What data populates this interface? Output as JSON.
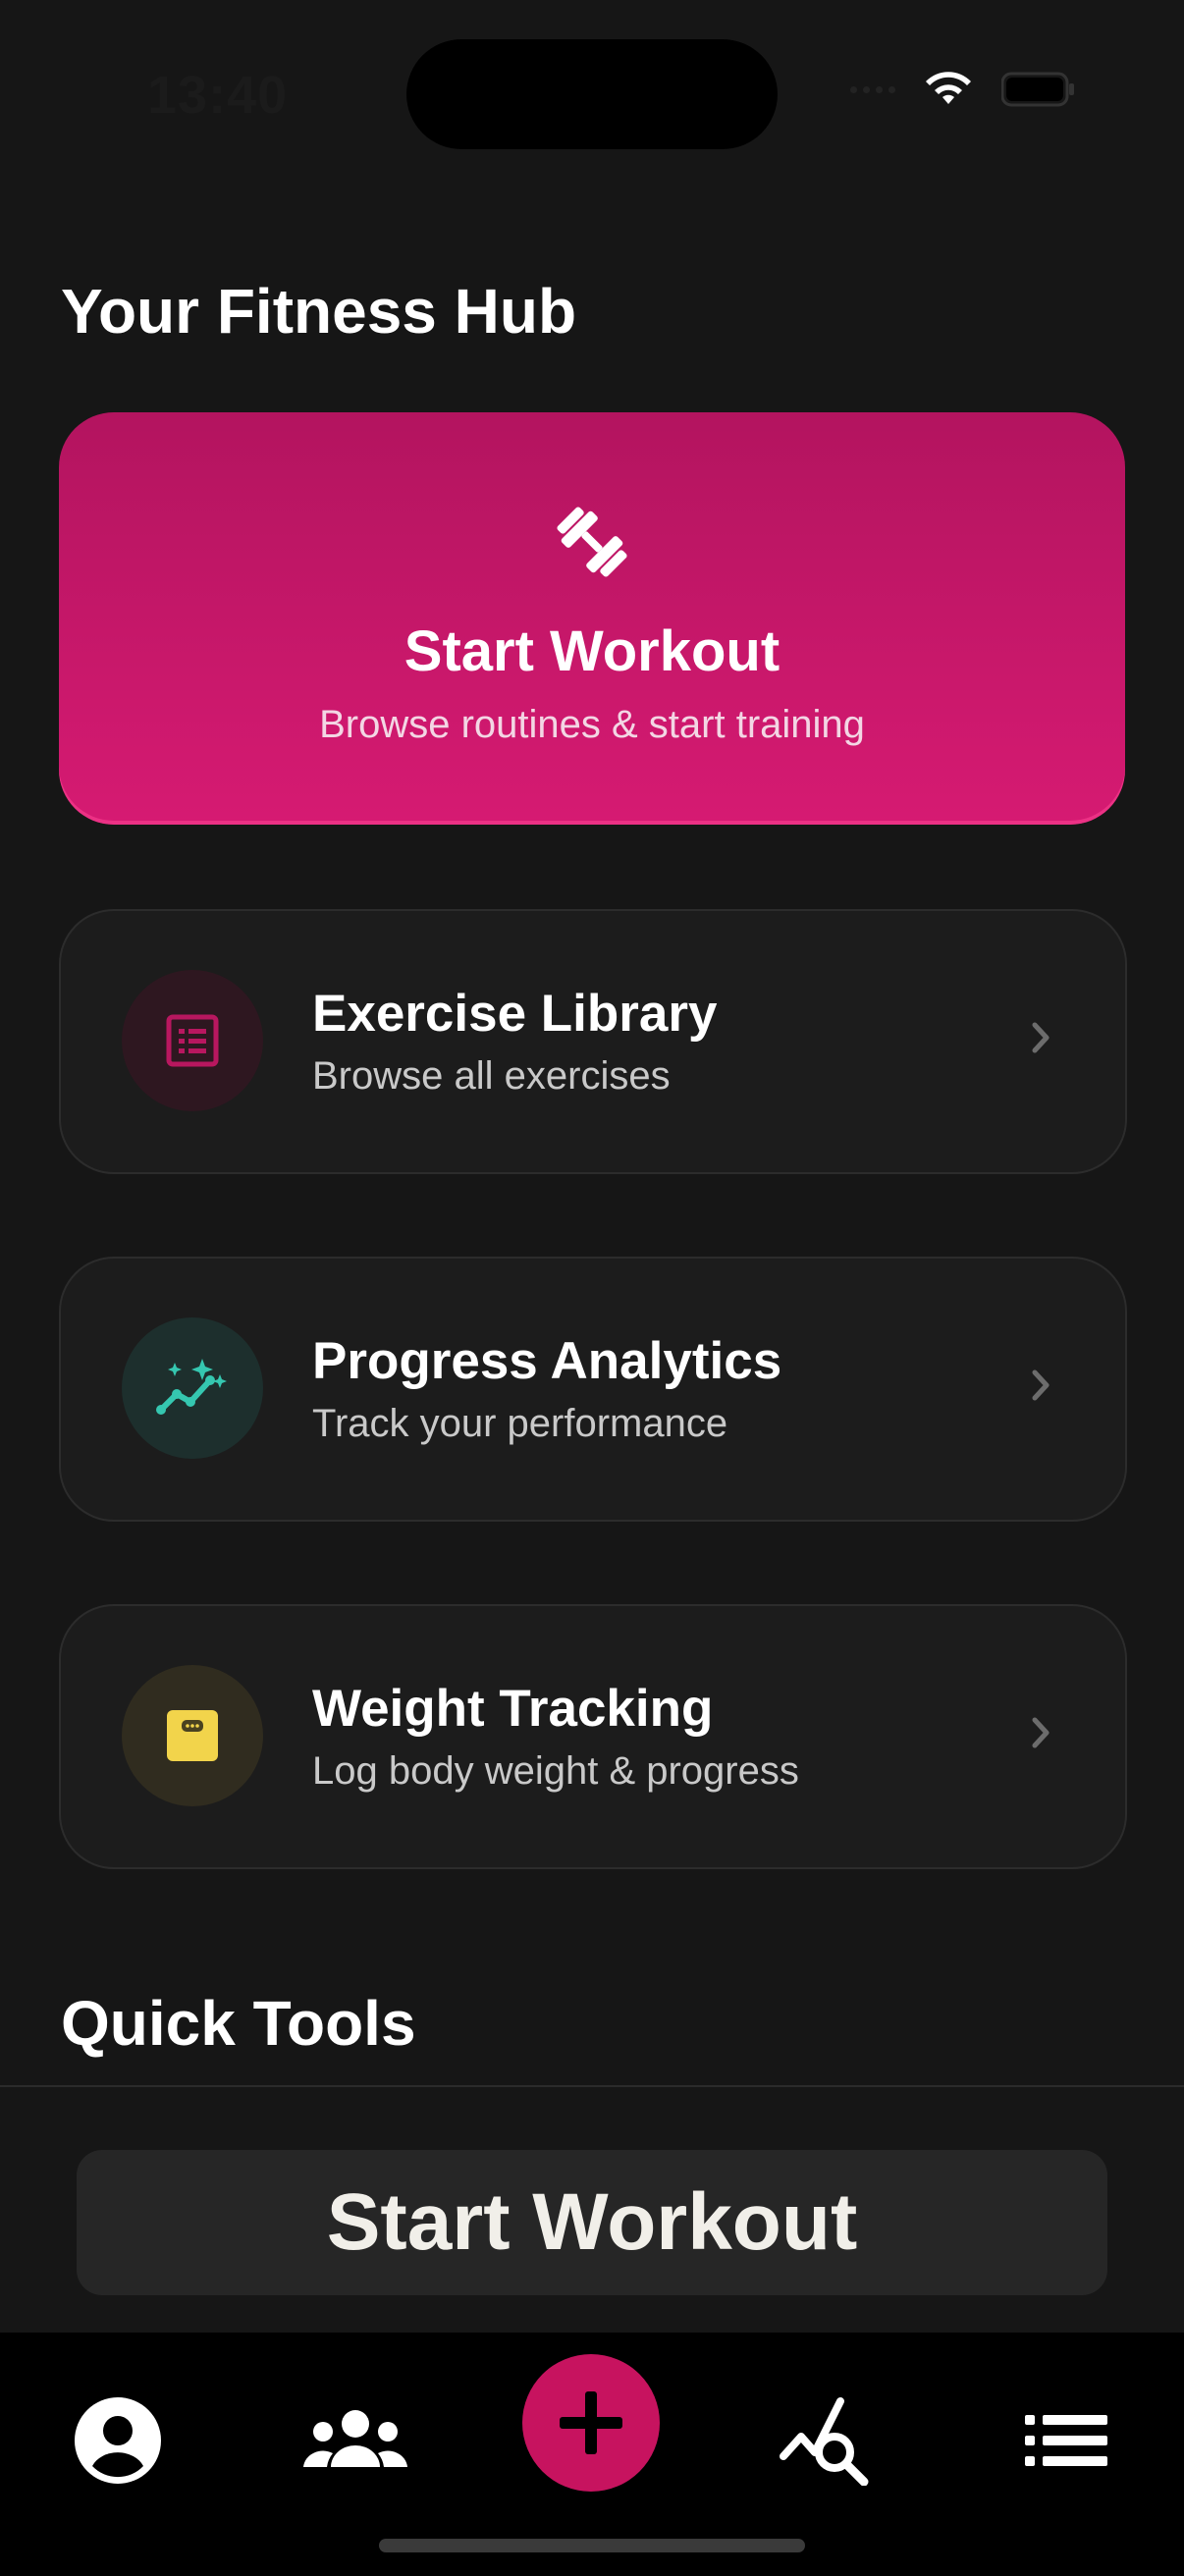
{
  "status_bar": {
    "time": "13:40"
  },
  "page_title": "Your Fitness Hub",
  "hero": {
    "title": "Start Workout",
    "subtitle": "Browse routines & start training",
    "icon": "dumbbell-icon",
    "colors": [
      "#b3145f",
      "#d61a72"
    ]
  },
  "cards": [
    {
      "title": "Exercise Library",
      "subtitle": "Browse all exercises",
      "icon": "list-icon",
      "accent": "#b8175f"
    },
    {
      "title": "Progress Analytics",
      "subtitle": "Track your performance",
      "icon": "sparkle-chart-icon",
      "accent": "#35c7b0"
    },
    {
      "title": "Weight Tracking",
      "subtitle": "Log body weight & progress",
      "icon": "scale-icon",
      "accent": "#f2d44b"
    }
  ],
  "section_title": "Quick Tools",
  "sticky_button": {
    "label": "Start Workout"
  },
  "tab_bar": {
    "tabs": [
      {
        "name": "profile",
        "icon": "person-icon"
      },
      {
        "name": "community",
        "icon": "group-icon"
      },
      {
        "name": "add",
        "icon": "plus-icon"
      },
      {
        "name": "analytics",
        "icon": "chart-search-icon"
      },
      {
        "name": "menu",
        "icon": "list-bullets-icon"
      }
    ]
  }
}
